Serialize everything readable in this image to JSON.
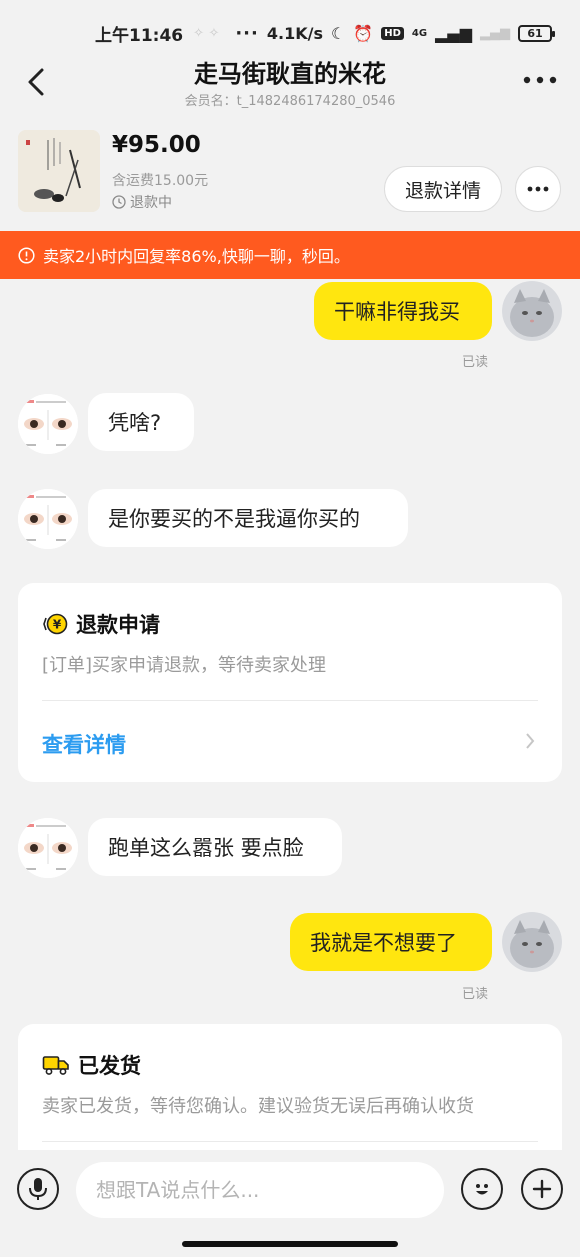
{
  "status_bar": {
    "time": "上午11:46",
    "dots": "···",
    "network_speed": "4.1K/s",
    "hd": "HD",
    "network_type": "4G",
    "battery": "61"
  },
  "header": {
    "title": "走马街耿直的米花",
    "member_label": "会员名：t_1482486174280_0546"
  },
  "product": {
    "price": "¥95.00",
    "shipping": "含运费15.00元",
    "status": "退款中",
    "refund_button": "退款详情"
  },
  "notice": {
    "text": "卖家2小时内回复率86%,快聊一聊，秒回。"
  },
  "messages": [
    {
      "side": "me",
      "text": "干嘛非得我买",
      "read": "已读"
    },
    {
      "side": "them",
      "text": "凭啥?"
    },
    {
      "side": "them",
      "text": "是你要买的不是我逼你买的"
    },
    {
      "side": "them",
      "text": "跑单这么嚣张 要点脸"
    },
    {
      "side": "me",
      "text": "我就是不想要了",
      "read": "已读"
    }
  ],
  "refund_card": {
    "title": "退款申请",
    "description": "[订单]买家申请退款，等待卖家处理",
    "link": "查看详情"
  },
  "shipped_card": {
    "title": "已发货",
    "description": "卖家已发货，等待您确认。建议验货无误后再确认收货"
  },
  "input_bar": {
    "placeholder": "想跟TA说点什么..."
  },
  "colors": {
    "accent_yellow": "#ffe60f",
    "notice_orange": "#ff5a1f",
    "link_blue": "#2c9cf0",
    "background": "#f2f2f2"
  },
  "icons": [
    "back-arrow-icon",
    "more-dots-icon",
    "clock-icon",
    "alert-circle-icon",
    "refund-yen-icon",
    "chevron-right-icon",
    "truck-icon",
    "microphone-icon",
    "emoji-icon",
    "plus-icon"
  ]
}
